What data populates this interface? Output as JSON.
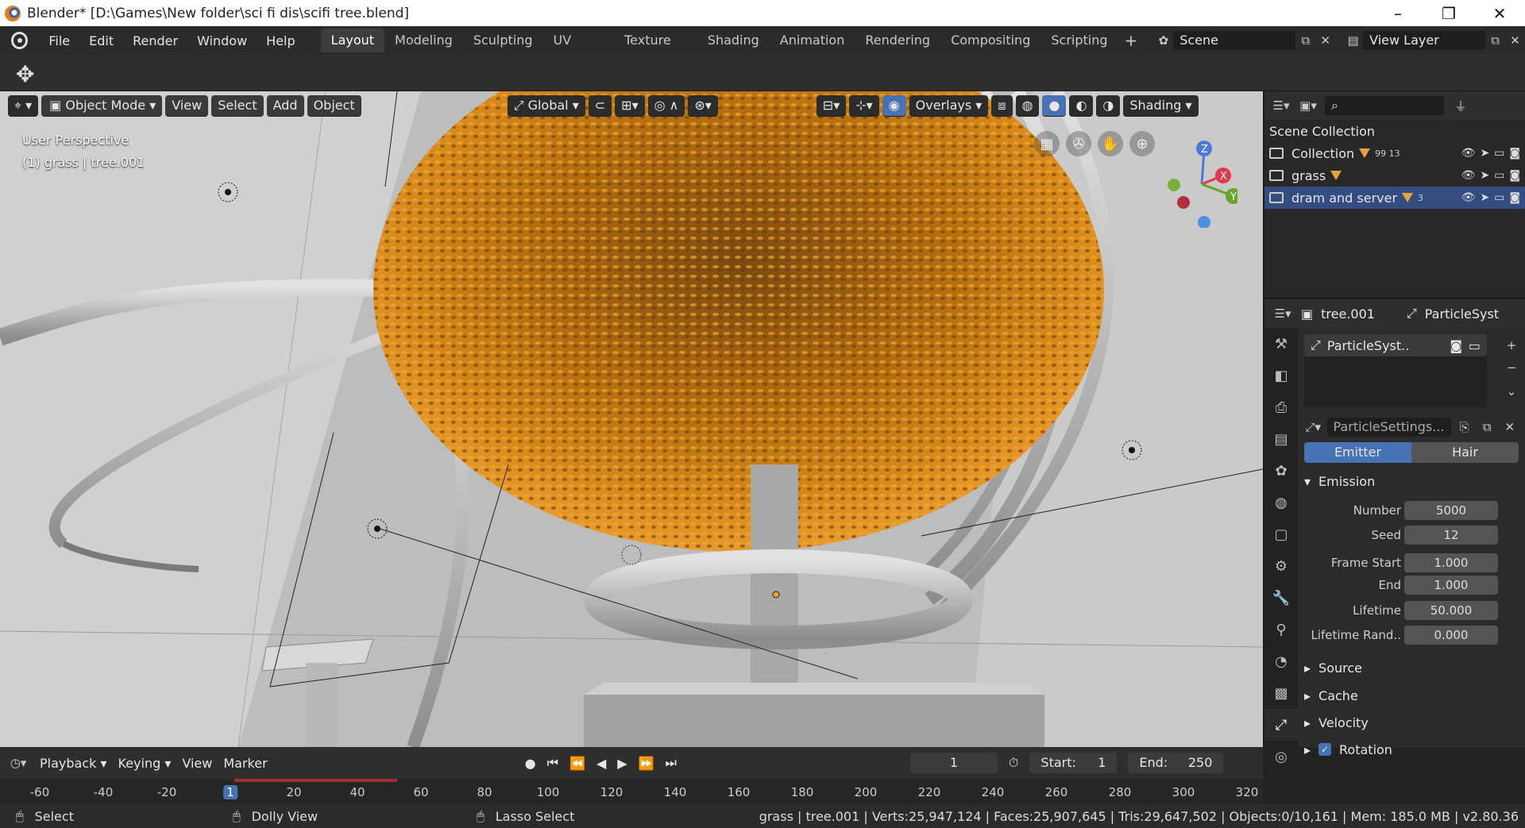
{
  "window": {
    "title": "Blender* [D:\\Games\\New folder\\sci fi dis\\scifi tree.blend]",
    "minimize": "–",
    "restore": "❐",
    "close": "✕"
  },
  "menu": [
    "File",
    "Edit",
    "Render",
    "Window",
    "Help"
  ],
  "workspaces": [
    "Layout",
    "Modeling",
    "Sculpting",
    "UV Editing",
    "Texture Paint",
    "Shading",
    "Animation",
    "Rendering",
    "Compositing",
    "Scripting"
  ],
  "workspace_plus": "+",
  "scene": {
    "name": "Scene",
    "view_layer": "View Layer"
  },
  "viewport": {
    "mode": "Object Mode",
    "view": "View",
    "select": "Select",
    "add": "Add",
    "object": "Object",
    "orientation": "Global",
    "overlays": "Overlays",
    "shading": "Shading",
    "perspective": "User Perspective",
    "active": "(1) grass | tree.001",
    "gizmo": {
      "z": "Z",
      "x": "X",
      "y": "Y"
    }
  },
  "outliner": {
    "rows": [
      {
        "name": "Scene Collection"
      },
      {
        "name": "Collection",
        "counts": "99 13"
      },
      {
        "name": "grass",
        "counts": ""
      },
      {
        "name": "dram and server",
        "counts": "3"
      }
    ]
  },
  "properties": {
    "object": "tree.001",
    "system_tab": "ParticleSyst",
    "list_item": "ParticleSyst..",
    "settings": "ParticleSettings...",
    "emitter": "Emitter",
    "hair": "Hair",
    "emission": "Emission",
    "fields": [
      {
        "label": "Number",
        "value": "5000"
      },
      {
        "label": "Seed",
        "value": "12"
      },
      {
        "label": "Frame Start",
        "value": "1.000"
      },
      {
        "label": "End",
        "value": "1.000"
      },
      {
        "label": "Lifetime",
        "value": "50.000"
      },
      {
        "label": "Lifetime Rand..",
        "value": "0.000"
      }
    ],
    "sections": [
      "Source",
      "Cache",
      "Velocity",
      "Rotation"
    ]
  },
  "timeline": {
    "playback": "Playback",
    "keying": "Keying",
    "view": "View",
    "marker": "Marker",
    "current": "1",
    "start_label": "Start:",
    "start": "1",
    "end_label": "End:",
    "end": "250",
    "ticks": [
      "-60",
      "-40",
      "-20",
      "1",
      "20",
      "40",
      "60",
      "80",
      "100",
      "120",
      "140",
      "160",
      "180",
      "200",
      "220",
      "240",
      "260",
      "280",
      "300",
      "320"
    ]
  },
  "status": {
    "select": "Select",
    "dolly": "Dolly View",
    "lasso": "Lasso Select",
    "stats": "grass | tree.001 | Verts:25,947,124 | Faces:25,907,645 | Tris:29,647,502 | Objects:0/10,161 | Mem: 185.0 MB | v2.80.36"
  },
  "colors": {
    "accent": "#4772b3",
    "selected_row": "#334d80",
    "foliage": "#d88a1a"
  }
}
